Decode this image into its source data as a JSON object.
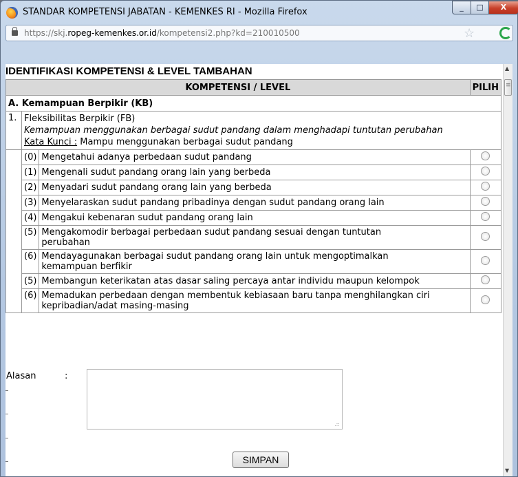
{
  "window": {
    "title": "STANDAR KOMPETENSI JABATAN - KEMENKES RI - Mozilla Firefox",
    "minimize": "_",
    "maximize": "□",
    "close": "X"
  },
  "urlbar": {
    "scheme": "https://skj.",
    "domain": "ropeg-kemenkes.or.id",
    "path": "/kompetensi2.php?kd=210010500"
  },
  "page": {
    "heading": "IDENTIFIKASI KOMPETENSI & LEVEL TAMBAHAN",
    "table": {
      "header_comp": "KOMPETENSI / LEVEL",
      "header_pilih": "PILIH",
      "section": "A. Kemampuan Berpikir (KB)",
      "item_number": "1.",
      "item_name": "Fleksibilitas Berpikir (FB)",
      "item_description": "Kemampuan menggunakan berbagai sudut pandang dalam menghadapi tuntutan perubahan",
      "keyword_label": "Kata Kunci :",
      "keyword_text": " Mampu menggunakan berbagai sudut pandang",
      "levels": [
        {
          "num": "(0)",
          "text": "Mengetahui adanya perbedaan sudut pandang"
        },
        {
          "num": "(1)",
          "text": "Mengenali sudut pandang orang lain yang berbeda"
        },
        {
          "num": "(2)",
          "text": "Menyadari sudut pandang orang lain yang berbeda"
        },
        {
          "num": "(3)",
          "text": "Menyelaraskan sudut pandang pribadinya dengan sudut pandang orang lain"
        },
        {
          "num": "(4)",
          "text": "Mengakui kebenaran sudut pandang orang lain"
        },
        {
          "num": "(5)",
          "text": "Mengakomodir berbagai perbedaan sudut pandang sesuai dengan tuntutan perubahan"
        },
        {
          "num": "(6)",
          "text": "Mendayagunakan berbagai sudut pandang orang lain untuk mengoptimalkan kemampuan berfikir"
        },
        {
          "num": "(5)",
          "text": "Membangun keterikatan atas dasar saling percaya antar individu maupun kelompok"
        },
        {
          "num": "(6)",
          "text": "Memadukan perbedaan dengan membentuk kebiasaan baru tanpa menghilangkan ciri kepribadian/adat masing-masing"
        }
      ]
    },
    "form": {
      "alasan_label": "Alasan",
      "colon": ":",
      "submit": "SIMPAN"
    }
  }
}
